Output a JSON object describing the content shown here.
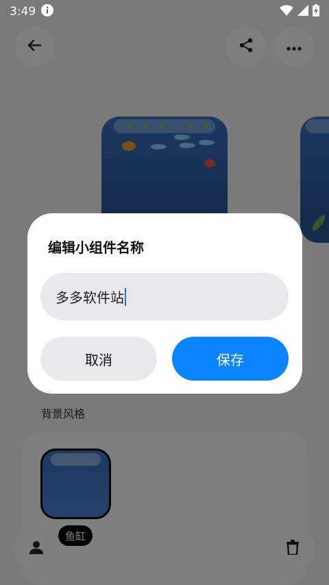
{
  "status_bar": {
    "time": "3:49"
  },
  "section": {
    "background_style_label": "背景风格"
  },
  "styles": {
    "selected_label": "鱼缸"
  },
  "dialog": {
    "title": "编辑小组件名称",
    "input_value": "多多软件站",
    "cancel_label": "取消",
    "save_label": "保存"
  },
  "colors": {
    "accent": "#0a84ff",
    "aquarium_blue": "#3b72c4"
  },
  "icons": {
    "back": "back-arrow-icon",
    "share": "share-icon",
    "more": "more-dots-icon",
    "person": "person-icon",
    "trash": "trash-icon"
  }
}
